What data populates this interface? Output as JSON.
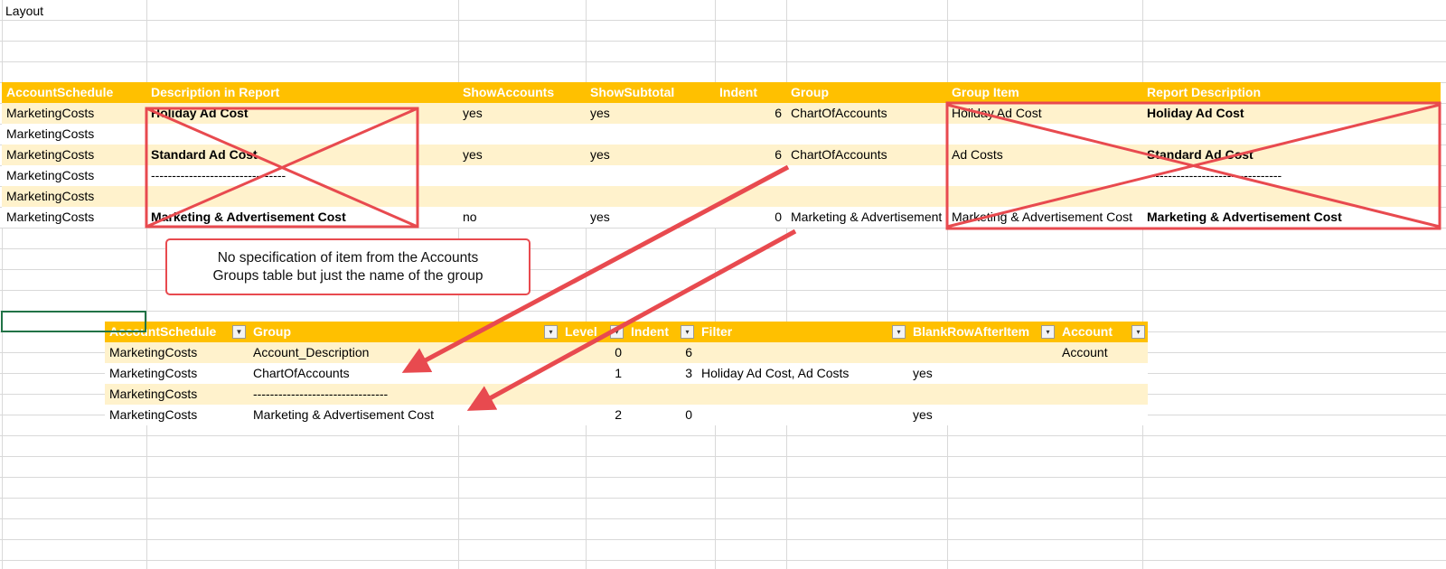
{
  "sheet_label": "Layout",
  "colors": {
    "header_bg": "#FFC000",
    "band_light": "#FFF2CC",
    "annotation_red": "#E84A4F",
    "selection_green": "#217346"
  },
  "layout_table": {
    "headers": [
      "AccountSchedule",
      "Description in Report",
      "ShowAccounts",
      "ShowSubtotal",
      "Indent",
      "Group",
      "Group Item",
      "Report Description"
    ],
    "rows": [
      [
        "MarketingCosts",
        "Holiday Ad Cost",
        "yes",
        "yes",
        "6",
        "ChartOfAccounts",
        "Holiday Ad Cost",
        "Holiday Ad Cost"
      ],
      [
        "MarketingCosts",
        "",
        "",
        "",
        "",
        "",
        "",
        ""
      ],
      [
        "MarketingCosts",
        "Standard Ad Cost",
        "yes",
        "yes",
        "6",
        "ChartOfAccounts",
        "Ad Costs",
        "Standard Ad Cost"
      ],
      [
        "MarketingCosts",
        "--------------------------------",
        "",
        "",
        "",
        "",
        "",
        "--------------------------------"
      ],
      [
        "MarketingCosts",
        "",
        "",
        "",
        "",
        "",
        "",
        ""
      ],
      [
        "MarketingCosts",
        "Marketing & Advertisement Cost",
        "no",
        "yes",
        "0",
        "Marketing & Advertisement Cost",
        "Marketing & Advertisement Cost",
        "Marketing & Advertisement Cost"
      ]
    ]
  },
  "callout": {
    "line1": "No specification of item from the Accounts",
    "line2": "Groups table but just the name of the group"
  },
  "group_table": {
    "headers": [
      "AccountSchedule",
      "Group",
      "Level",
      "Indent",
      "Filter",
      "BlankRowAfterItem",
      "Account"
    ],
    "filter_icons": [
      "filter-applied-icon",
      "dropdown-arrow-icon",
      "dropdown-arrow-icon",
      "dropdown-arrow-icon",
      "dropdown-arrow-icon",
      "dropdown-arrow-icon",
      "dropdown-arrow-icon"
    ],
    "rows": [
      [
        "MarketingCosts",
        "Account_Description",
        "0",
        "6",
        "",
        "",
        "Account"
      ],
      [
        "MarketingCosts",
        "ChartOfAccounts",
        "1",
        "3",
        "Holiday Ad Cost, Ad Costs",
        "yes",
        ""
      ],
      [
        "MarketingCosts",
        "--------------------------------",
        "",
        "",
        "",
        "",
        ""
      ],
      [
        "MarketingCosts",
        "Marketing & Advertisement Cost",
        "2",
        "0",
        "",
        "yes",
        ""
      ]
    ]
  }
}
